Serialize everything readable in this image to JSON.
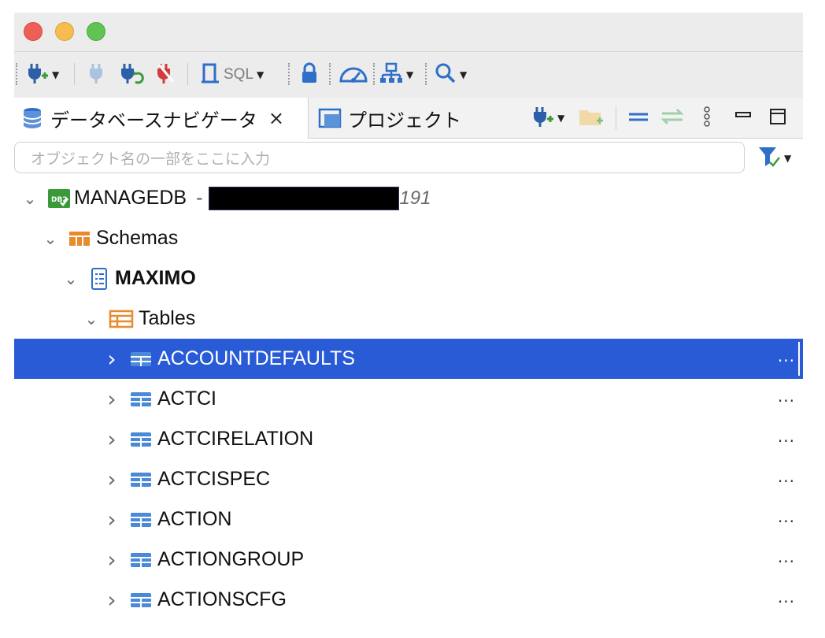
{
  "toolbar": {
    "sql_label": "SQL",
    "items": [
      "new-connection-icon",
      "disconnect-icon",
      "reconnect-icon",
      "disconnect-all-icon",
      "sql-editor-icon",
      "lock-icon",
      "dashboard-icon",
      "network-icon",
      "search-icon"
    ]
  },
  "tabs": {
    "navigator_label": "データベースナビゲータ",
    "navigator_close": "×",
    "projects_label": "プロジェクト"
  },
  "search": {
    "placeholder": "オブジェクト名の一部をここに入力"
  },
  "tree": {
    "connection": {
      "name": "MANAGEDB",
      "separator": "-",
      "suffix": "191"
    },
    "schemas": "Schemas",
    "schema": "MAXIMO",
    "tables": "Tables",
    "items": [
      {
        "label": "ACCOUNTDEFAULTS",
        "selected": true
      },
      {
        "label": "ACTCI",
        "selected": false
      },
      {
        "label": "ACTCIRELATION",
        "selected": false
      },
      {
        "label": "ACTCISPEC",
        "selected": false
      },
      {
        "label": "ACTION",
        "selected": false
      },
      {
        "label": "ACTIONGROUP",
        "selected": false
      },
      {
        "label": "ACTIONSCFG",
        "selected": false
      }
    ],
    "more": "..."
  },
  "colors": {
    "selection": "#2a5bd7",
    "accent": "#2f6fc9"
  }
}
